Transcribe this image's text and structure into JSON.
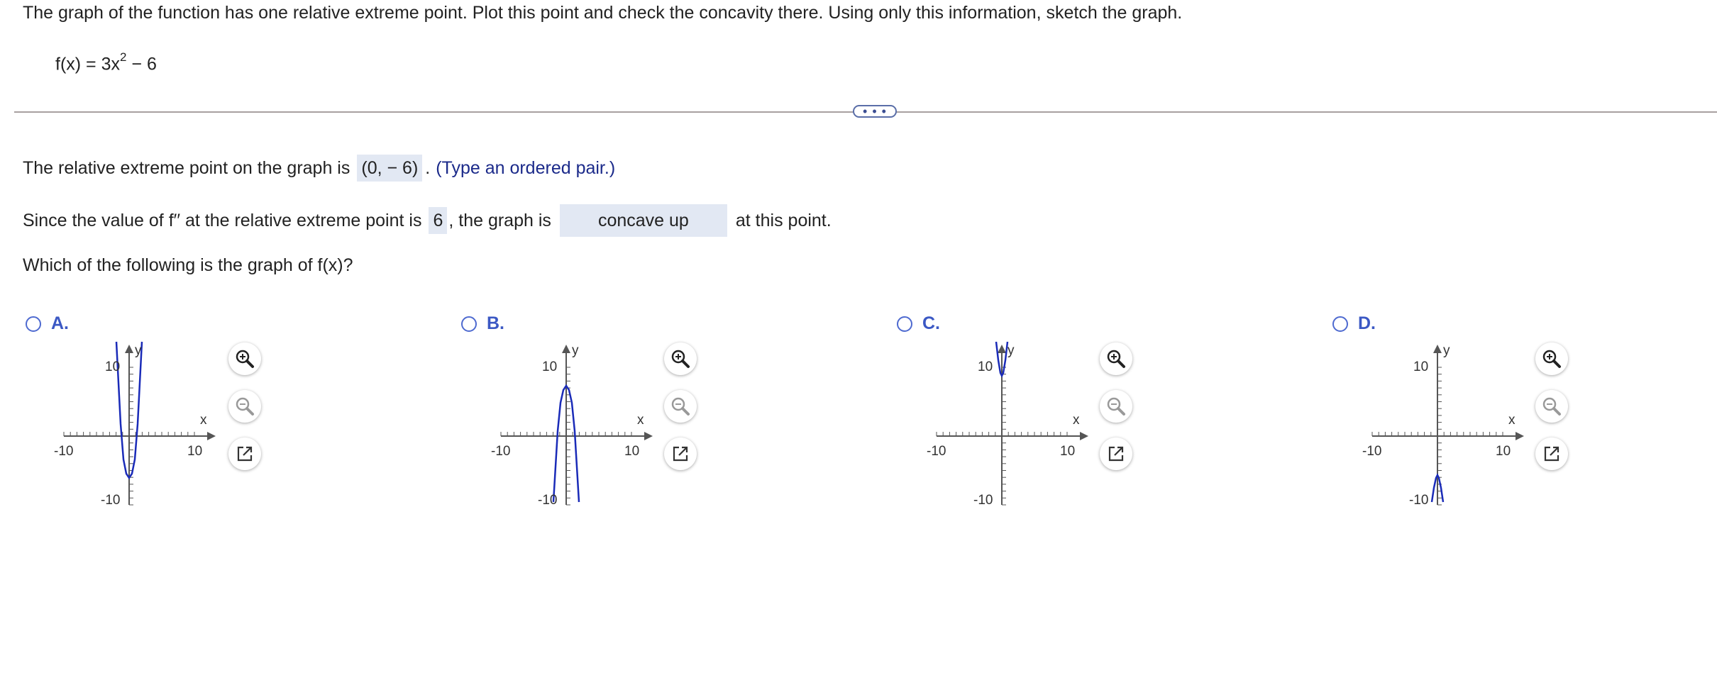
{
  "question": {
    "prompt": "The graph of the function has one relative extreme point. Plot this point and check the concavity there. Using only this information, sketch the graph.",
    "function_lhs": "f(x) = 3x",
    "function_exp": "2",
    "function_rhs": " − 6"
  },
  "expander_label": "• • •",
  "answer1": {
    "prefix": "The relative extreme point on the graph is",
    "value": "(0, − 6)",
    "suffix": ".",
    "hint": "(Type an ordered pair.)"
  },
  "answer2": {
    "prefix": "Since the value of f′′ at the relative extreme point is",
    "value": "6",
    "middle": ", the graph is",
    "dropdown_value": "concave up",
    "suffix": "at this point."
  },
  "which_question": "Which of the following is the graph of f(x)?",
  "choices": [
    {
      "letter": "A.",
      "axis": {
        "y": "y",
        "x": "x",
        "ytop": "10",
        "ybot": "-10",
        "xleft": "-10",
        "xright": "10"
      }
    },
    {
      "letter": "B.",
      "axis": {
        "y": "y",
        "x": "x",
        "ytop": "10",
        "ybot": "-10",
        "xleft": "-10",
        "xright": "10"
      }
    },
    {
      "letter": "C.",
      "axis": {
        "y": "y",
        "x": "x",
        "ytop": "10",
        "ybot": "-10",
        "xleft": "-10",
        "xright": "10"
      }
    },
    {
      "letter": "D.",
      "axis": {
        "y": "y",
        "x": "x",
        "ytop": "10",
        "ybot": "-10",
        "xleft": "-10",
        "xright": "10"
      }
    }
  ],
  "colors": {
    "curve": "#1a2bb8",
    "axis": "#555555",
    "accent": "#3b58c4",
    "answer_bg": "#e2e8f3"
  },
  "icons": [
    "zoom-in-icon",
    "zoom-out-icon",
    "open-in-new-window-icon"
  ]
}
